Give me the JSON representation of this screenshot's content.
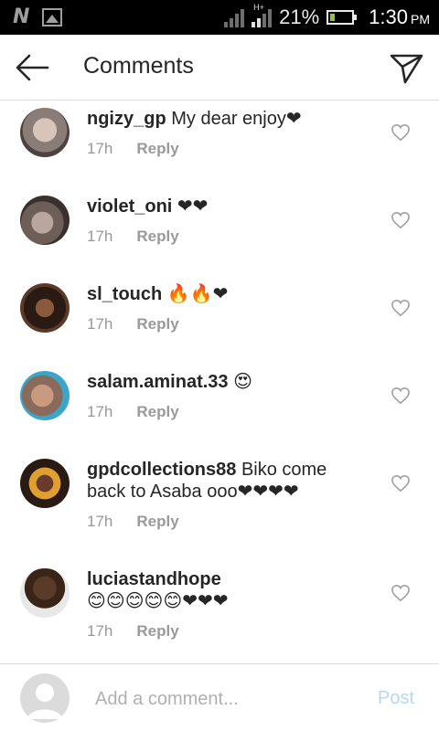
{
  "status_bar": {
    "n_icon": "N",
    "network_type": "H+",
    "battery_percent": "21%",
    "battery_level": 0.21,
    "time": "1:30",
    "ampm": "PM"
  },
  "header": {
    "title": "Comments",
    "back_icon": "arrow-left-icon",
    "send_icon": "paper-plane-icon"
  },
  "comments": [
    {
      "username": "ngizy_gp",
      "text": "My dear enjoy❤",
      "time": "17h",
      "reply_label": "Reply"
    },
    {
      "username": "violet_oni",
      "text": "❤❤",
      "time": "17h",
      "reply_label": "Reply"
    },
    {
      "username": "sl_touch",
      "text": "🔥🔥❤",
      "time": "17h",
      "reply_label": "Reply"
    },
    {
      "username": "salam.aminat.33",
      "text": "😍",
      "time": "17h",
      "reply_label": "Reply"
    },
    {
      "username": "gpdcollections88",
      "text": "Biko come back to Asaba ooo❤❤❤❤",
      "time": "17h",
      "reply_label": "Reply"
    },
    {
      "username": "luciastandhope",
      "text": "😊😊😊😊😊❤❤❤",
      "time": "17h",
      "reply_label": "Reply"
    }
  ],
  "composer": {
    "placeholder": "Add a comment...",
    "post_label": "Post"
  },
  "colors": {
    "post_disabled": "#b3d8f7",
    "meta_text": "#999999",
    "divider": "#dbdbdb"
  }
}
